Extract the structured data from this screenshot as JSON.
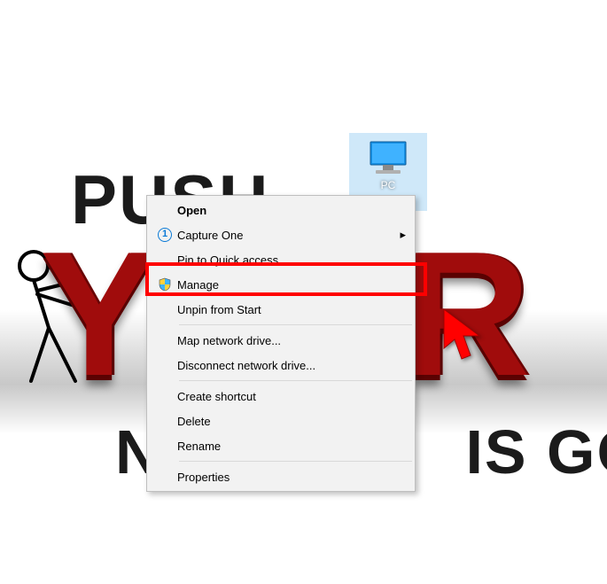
{
  "wallpaper": {
    "line1": "PUSH",
    "line2": "YOUR",
    "line3_left": "N",
    "line3_right": "IS GOIN"
  },
  "desktop": {
    "this_pc_label": "PC"
  },
  "context_menu": {
    "open": "Open",
    "capture_one": "Capture One",
    "pin_quick_access": "Pin to Quick access",
    "manage": "Manage",
    "unpin_start": "Unpin from Start",
    "map_drive": "Map network drive...",
    "disconnect_drive": "Disconnect network drive...",
    "create_shortcut": "Create shortcut",
    "delete": "Delete",
    "rename": "Rename",
    "properties": "Properties"
  }
}
